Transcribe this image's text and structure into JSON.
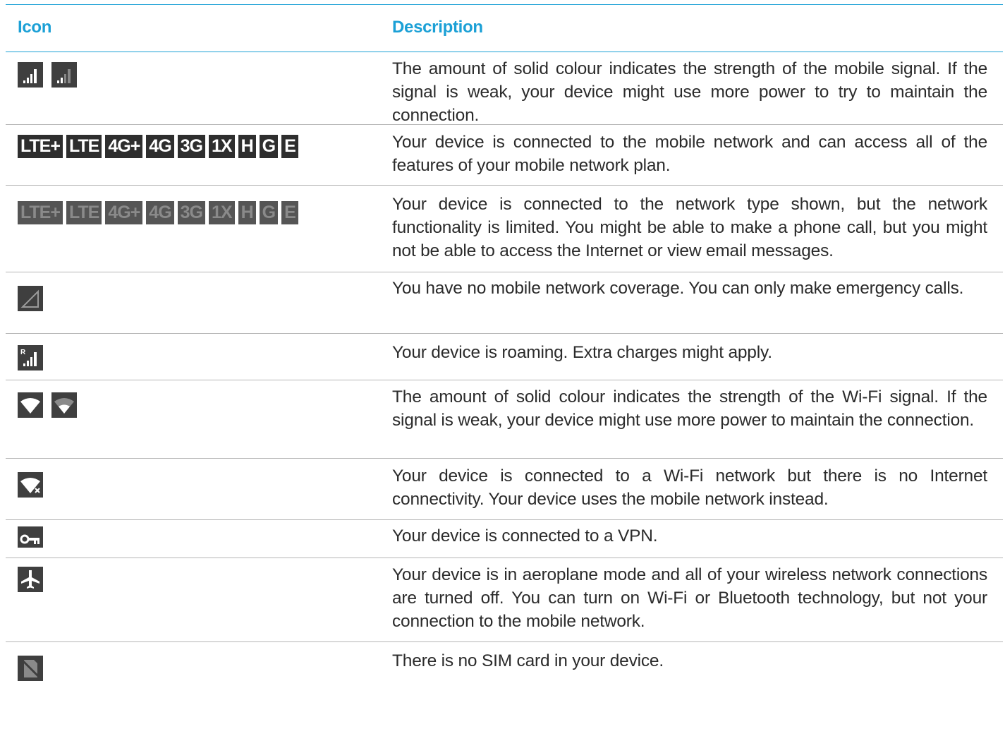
{
  "header": {
    "icon_col": "Icon",
    "desc_col": "Description"
  },
  "rows": [
    {
      "icons": [
        "signal-full-icon",
        "signal-partial-icon"
      ],
      "description": "The amount of solid colour indicates the strength of the mobile signal. If the signal is weak, your device might use more power to try to maintain the connection."
    },
    {
      "badges": [
        "LTE+",
        "LTE",
        "4G+",
        "4G",
        "3G",
        "1X",
        "H",
        "G",
        "E"
      ],
      "description": "Your device is connected to the mobile network and can access all of the features of your mobile network plan."
    },
    {
      "badges": [
        "LTE+",
        "LTE",
        "4G+",
        "4G",
        "3G",
        "1X",
        "H",
        "G",
        "E"
      ],
      "description": "Your device is connected to the network type shown, but the network functionality is limited. You might be able to make a phone call, but you might not be able to access the Internet or view email messages."
    },
    {
      "icons": [
        "no-signal-icon"
      ],
      "description": "You have no mobile network coverage. You can only make emergency calls."
    },
    {
      "icons": [
        "roaming-icon"
      ],
      "roaming_label": "R",
      "description": "Your device is roaming. Extra charges might apply."
    },
    {
      "icons": [
        "wifi-full-icon",
        "wifi-partial-icon"
      ],
      "description": "The amount of solid colour indicates the strength of the Wi-Fi signal. If the signal is weak, your device might use more power to maintain the connection."
    },
    {
      "icons": [
        "wifi-no-internet-icon"
      ],
      "description": "Your device is connected to a Wi-Fi network but there is no Internet connectivity. Your device uses the mobile network instead."
    },
    {
      "icons": [
        "vpn-key-icon"
      ],
      "description": "Your device is connected to a VPN."
    },
    {
      "icons": [
        "airplane-icon"
      ],
      "description": "Your device is in aeroplane mode and all of your wireless network connections are turned off. You can turn on Wi-Fi or Bluetooth technology, but not your connection to the mobile network."
    },
    {
      "icons": [
        "no-sim-icon"
      ],
      "description": "There is no SIM card in your device."
    }
  ],
  "colors": {
    "accent": "#1ba0d6",
    "icon_bg": "#3f3f3f",
    "text": "#2b2b2b",
    "divider": "#b5b5b5"
  }
}
